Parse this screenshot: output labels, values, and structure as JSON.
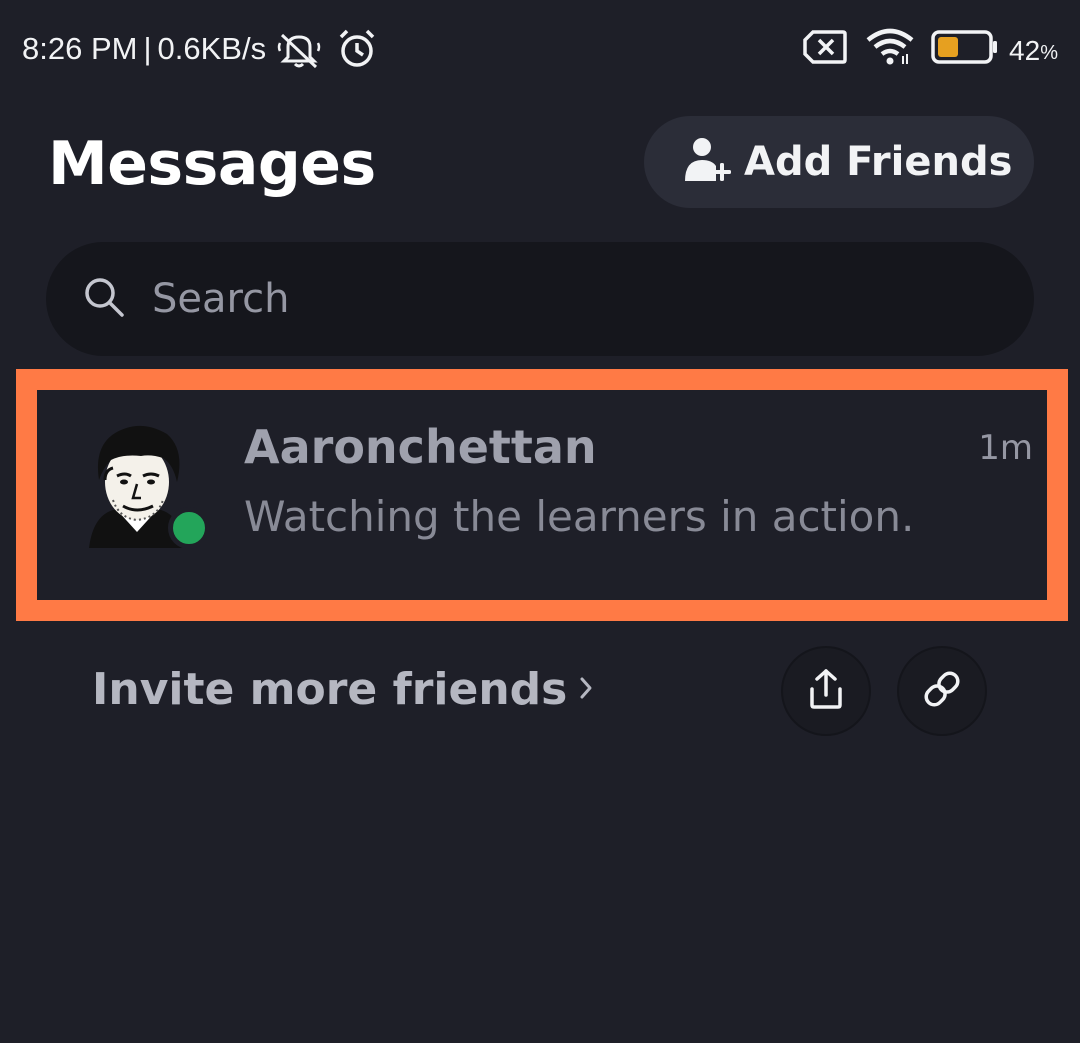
{
  "status_bar": {
    "time": "8:26 PM",
    "separator": "|",
    "network_speed": "0.6KB/s",
    "battery_percent": "42",
    "battery_percent_sign": "%",
    "battery_level": 0.42,
    "icons": [
      "mute-icon",
      "alarm-icon",
      "no-sim-icon",
      "wifi-icon",
      "battery-icon"
    ]
  },
  "header": {
    "title": "Messages",
    "add_friends_label": "Add Friends"
  },
  "search": {
    "placeholder": "Search"
  },
  "conversations": [
    {
      "name": "Aaronchettan",
      "preview": "Watching the learners in action.",
      "time": "1m",
      "status": "online"
    }
  ],
  "invite": {
    "label": "Invite more friends",
    "chevron": "›"
  },
  "colors": {
    "background": "#1e1f28",
    "highlight": "#ff7a45",
    "online": "#23a55a",
    "battery_fill": "#e6a020"
  }
}
